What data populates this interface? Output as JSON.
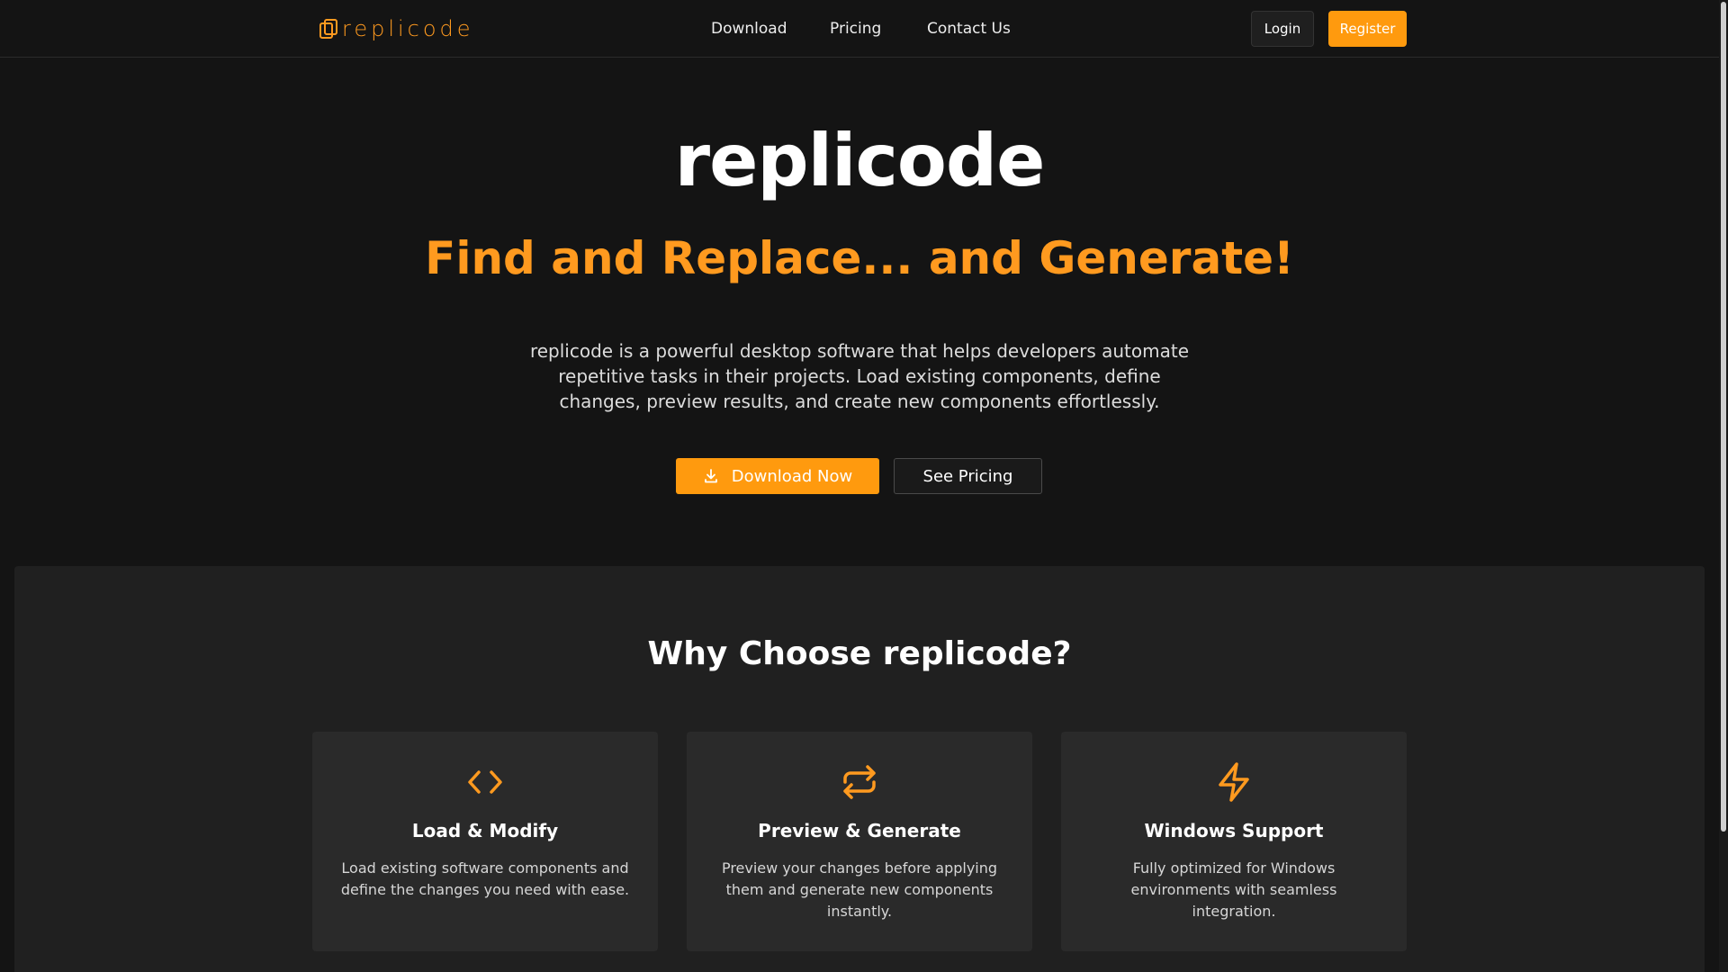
{
  "header": {
    "logo_text": "replicode",
    "nav": [
      "Download",
      "Pricing",
      "Contact Us"
    ],
    "login_label": "Login",
    "register_label": "Register"
  },
  "hero": {
    "title": "replicode",
    "subtitle": "Find and Replace... and Generate!",
    "description": "replicode is a powerful desktop software that helps developers automate repetitive tasks in their projects. Load existing components, define changes, preview results, and create new components effortlessly.",
    "download_label": "Download Now",
    "pricing_label": "See Pricing"
  },
  "features": {
    "title": "Why Choose replicode?",
    "cards": [
      {
        "icon": "code-icon",
        "title": "Load & Modify",
        "text": "Load existing software components and define the changes you need with ease."
      },
      {
        "icon": "repeat-icon",
        "title": "Preview & Generate",
        "text": "Preview your changes before applying them and generate new components instantly."
      },
      {
        "icon": "lightning-icon",
        "title": "Windows Support",
        "text": "Fully optimized for Windows environments with seamless integration."
      }
    ]
  },
  "colors": {
    "accent": "#ff9a0e",
    "background": "#141414",
    "section_bg": "#202020",
    "card_bg": "#2a2a2a"
  }
}
